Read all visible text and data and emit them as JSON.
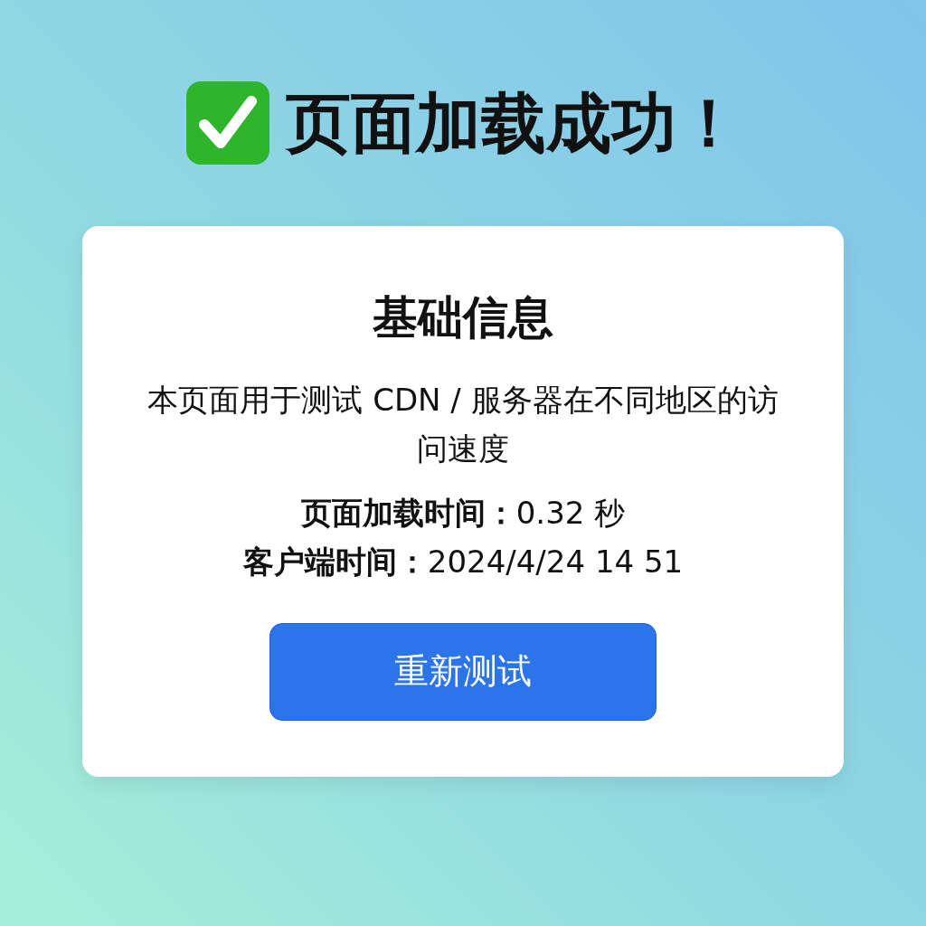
{
  "heading": "页面加载成功！",
  "card": {
    "title": "基础信息",
    "description": "本页面用于测试 CDN / 服务器在不同地区的访问速度",
    "stats": [
      {
        "label": "页面加载时间：",
        "value": "0.32 秒"
      },
      {
        "label": "客户端时间：",
        "value": "2024/4/24 14 51"
      }
    ],
    "button": "重新测试"
  }
}
